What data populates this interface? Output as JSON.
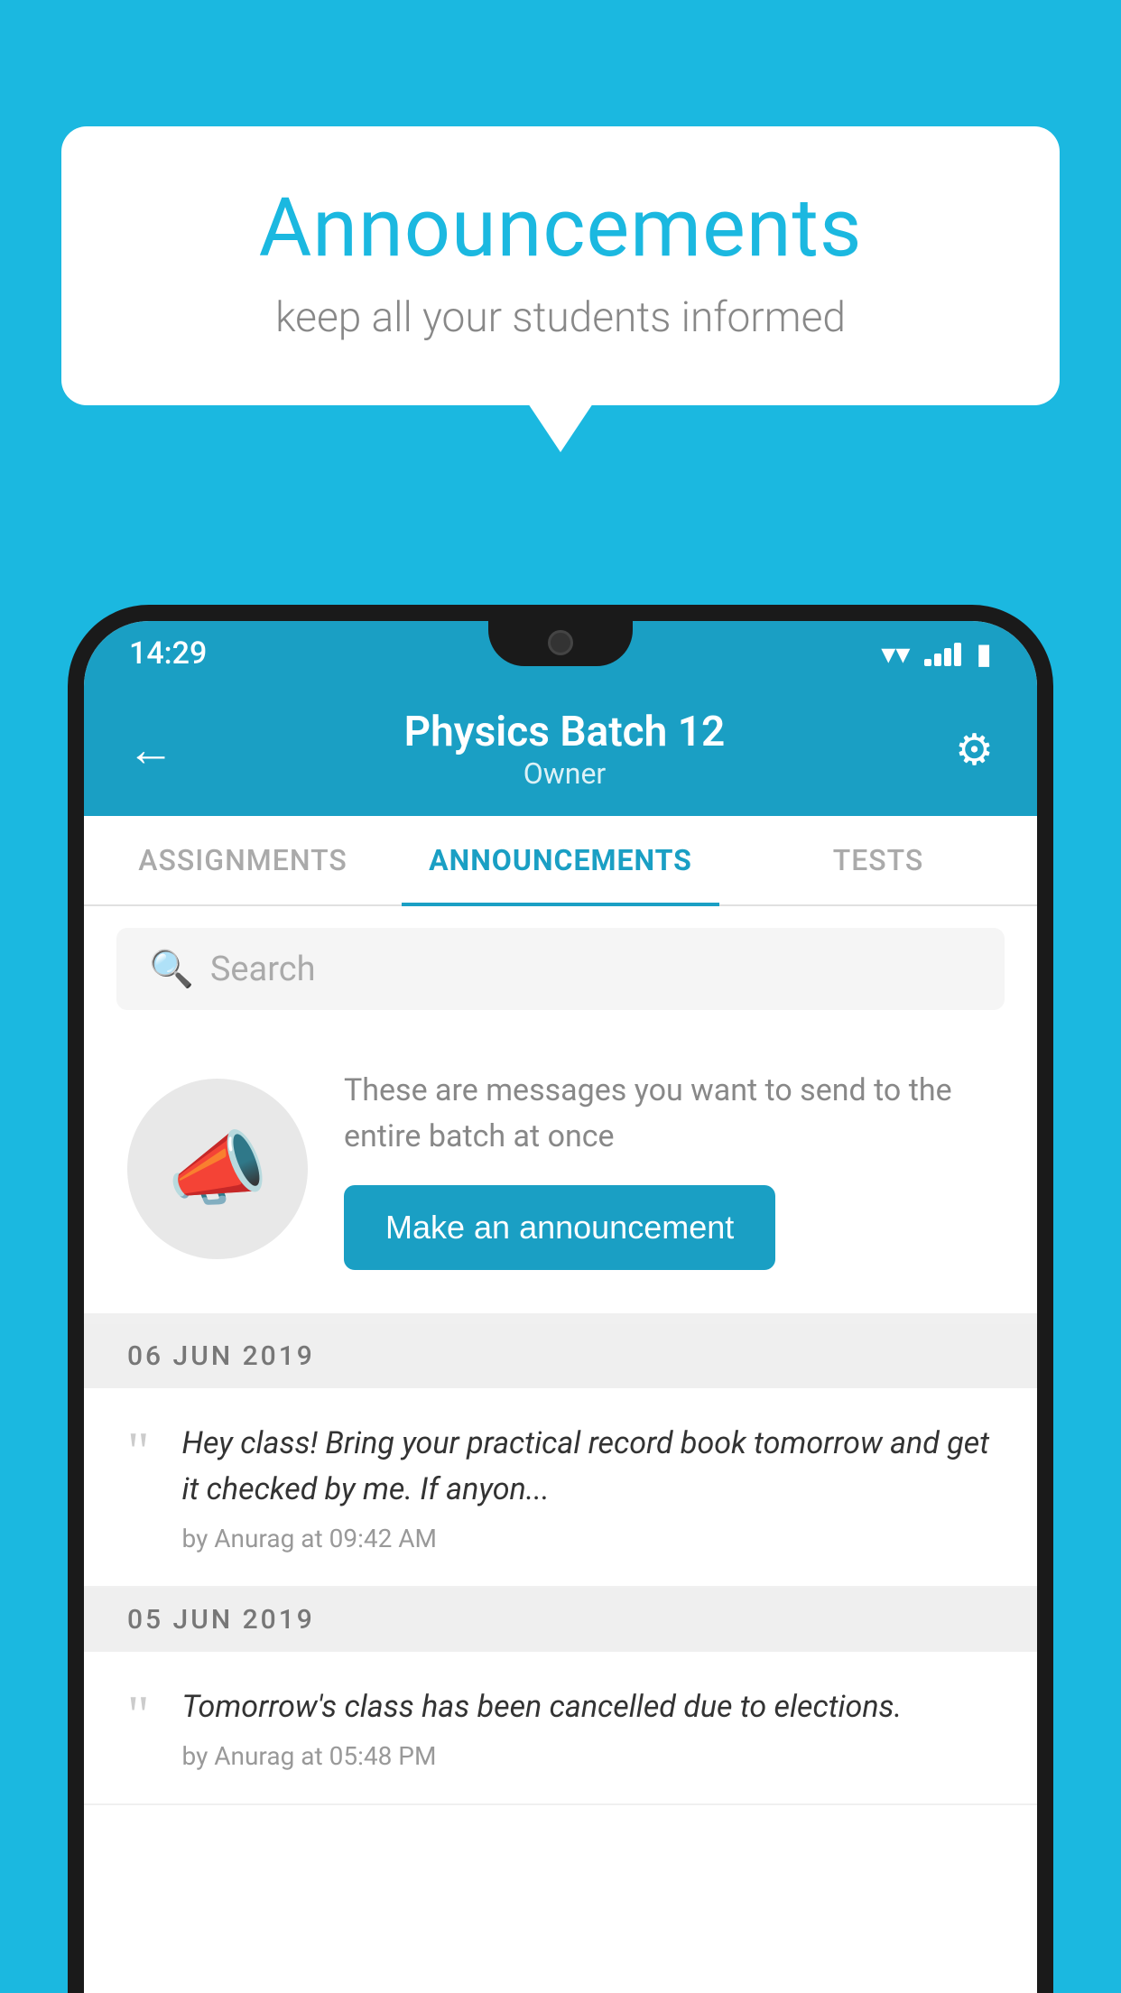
{
  "bubble": {
    "title": "Announcements",
    "subtitle": "keep all your students informed"
  },
  "statusBar": {
    "time": "14:29",
    "wifiIcon": "wifi",
    "batteryIcon": "battery"
  },
  "header": {
    "backLabel": "←",
    "title": "Physics Batch 12",
    "subtitle": "Owner",
    "gearLabel": "⚙"
  },
  "tabs": [
    {
      "label": "ASSIGNMENTS",
      "active": false
    },
    {
      "label": "ANNOUNCEMENTS",
      "active": true
    },
    {
      "label": "TESTS",
      "active": false
    }
  ],
  "search": {
    "placeholder": "Search"
  },
  "promo": {
    "description": "These are messages you want to send to the entire batch at once",
    "buttonLabel": "Make an announcement"
  },
  "dateGroups": [
    {
      "date": "06  JUN  2019",
      "items": [
        {
          "text": "Hey class! Bring your practical record book tomorrow and get it checked by me. If anyon...",
          "meta": "by Anurag at 09:42 AM"
        }
      ]
    },
    {
      "date": "05  JUN  2019",
      "items": [
        {
          "text": "Tomorrow's class has been cancelled due to elections.",
          "meta": "by Anurag at 05:48 PM"
        }
      ]
    }
  ],
  "colors": {
    "brand": "#1bb8e0",
    "headerBg": "#1a9fc4",
    "activeTab": "#1a9fc4",
    "btnBg": "#1a9fc4"
  }
}
